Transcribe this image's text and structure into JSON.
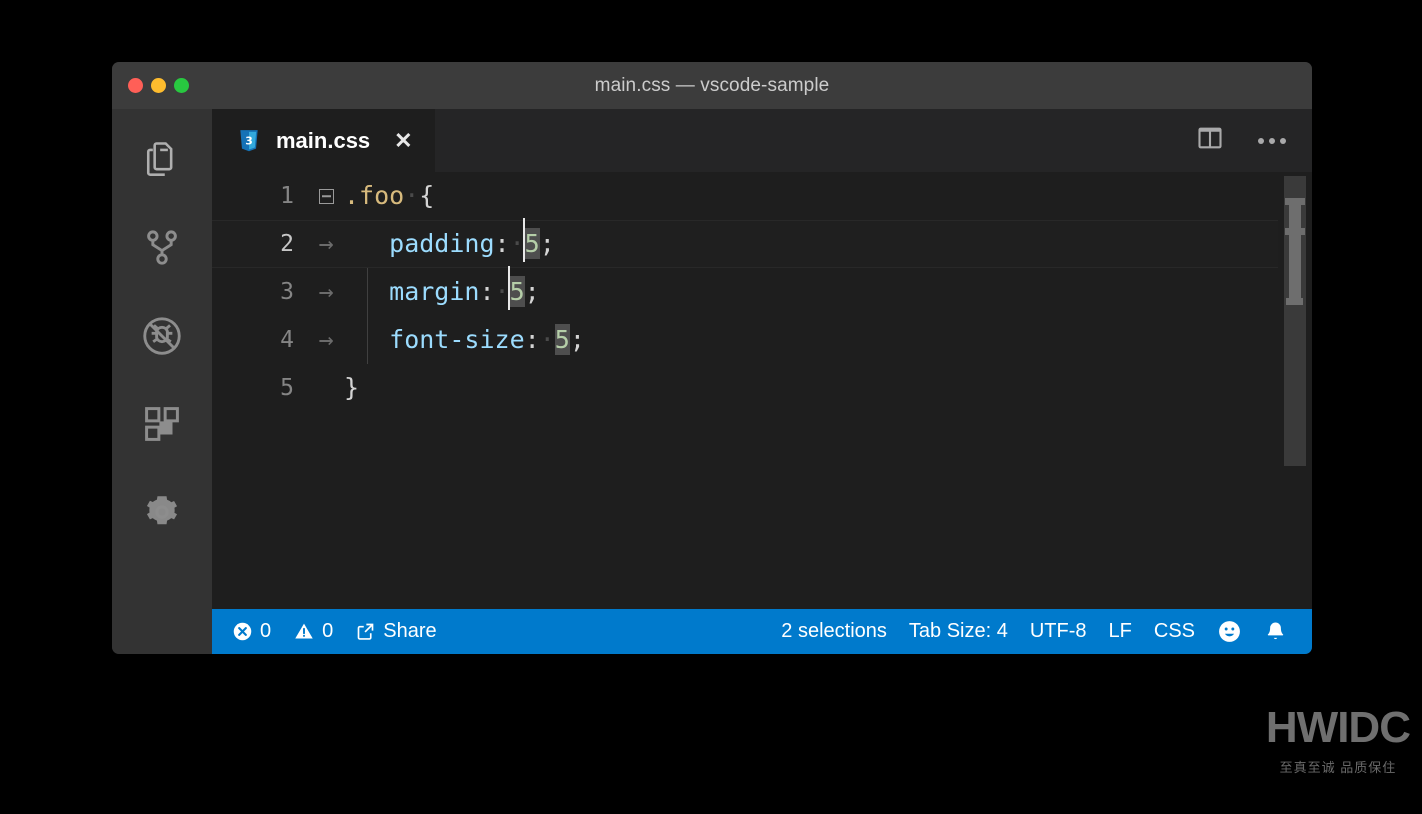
{
  "window": {
    "title": "main.css — vscode-sample",
    "traffic_lights": [
      {
        "name": "close",
        "color": "#ff5f57"
      },
      {
        "name": "minimize",
        "color": "#febc2e"
      },
      {
        "name": "maximize",
        "color": "#28c840"
      }
    ]
  },
  "activitybar": {
    "items": [
      {
        "name": "explorer",
        "icon": "files-icon"
      },
      {
        "name": "source-control",
        "icon": "source-control-icon"
      },
      {
        "name": "run-and-debug",
        "icon": "debug-disabled-icon"
      },
      {
        "name": "extensions",
        "icon": "extensions-icon"
      },
      {
        "name": "settings",
        "icon": "gear-icon"
      }
    ]
  },
  "tabbar": {
    "tabs": [
      {
        "label": "main.css",
        "icon": "css-file-icon",
        "close_label": "✕",
        "active": true
      }
    ],
    "actions": [
      {
        "name": "split-editor",
        "icon": "split-editor-icon"
      },
      {
        "name": "more-actions",
        "icon": "ellipsis-icon"
      }
    ]
  },
  "editor": {
    "language": "css",
    "lines": [
      {
        "number": "1",
        "current": false,
        "fold": true,
        "tab": false
      },
      {
        "number": "2",
        "current": true,
        "fold": false,
        "tab": true
      },
      {
        "number": "3",
        "current": false,
        "fold": false,
        "tab": true
      },
      {
        "number": "4",
        "current": false,
        "fold": false,
        "tab": true
      },
      {
        "number": "5",
        "current": false,
        "fold": false,
        "tab": false
      }
    ],
    "code": {
      "l1_selector": ".foo",
      "l1_space": "·",
      "l1_brace": "{",
      "l2_prop": "padding",
      "l2_colon": ":",
      "l2_space": "·",
      "l2_value": "5",
      "l2_semi": ";",
      "l3_prop": "margin",
      "l3_colon": ":",
      "l3_space": "·",
      "l3_value": "5",
      "l3_semi": ";",
      "l4_prop": "font-size",
      "l4_colon": ":",
      "l4_space": "·",
      "l4_value": "5",
      "l4_semi": ";",
      "l5_brace": "}",
      "tab_arrow": "→"
    },
    "colors": {
      "background": "#1e1e1e",
      "selector": "#d7ba7d",
      "property": "#9cdcfe",
      "number": "#b5cea8",
      "punctuation": "#d4d4d4",
      "selection": "#4e4e4e",
      "cursor": "#e8e8e8"
    }
  },
  "statusbar": {
    "background": "#007acc",
    "left": [
      {
        "name": "errors",
        "icon": "error-icon",
        "value": "0"
      },
      {
        "name": "warnings",
        "icon": "warning-icon",
        "value": "0"
      },
      {
        "name": "share",
        "icon": "share-icon",
        "value": "Share"
      }
    ],
    "right": [
      {
        "name": "selections",
        "value": "2 selections"
      },
      {
        "name": "tab-size",
        "value": "Tab Size: 4"
      },
      {
        "name": "encoding",
        "value": "UTF-8"
      },
      {
        "name": "eol",
        "value": "LF"
      },
      {
        "name": "language-mode",
        "value": "CSS"
      },
      {
        "name": "feedback",
        "icon": "smiley-icon",
        "value": ""
      },
      {
        "name": "notifications",
        "icon": "bell-icon",
        "value": ""
      }
    ]
  },
  "watermark": {
    "main": "HWIDC",
    "sub": "至真至诚 品质保住"
  }
}
